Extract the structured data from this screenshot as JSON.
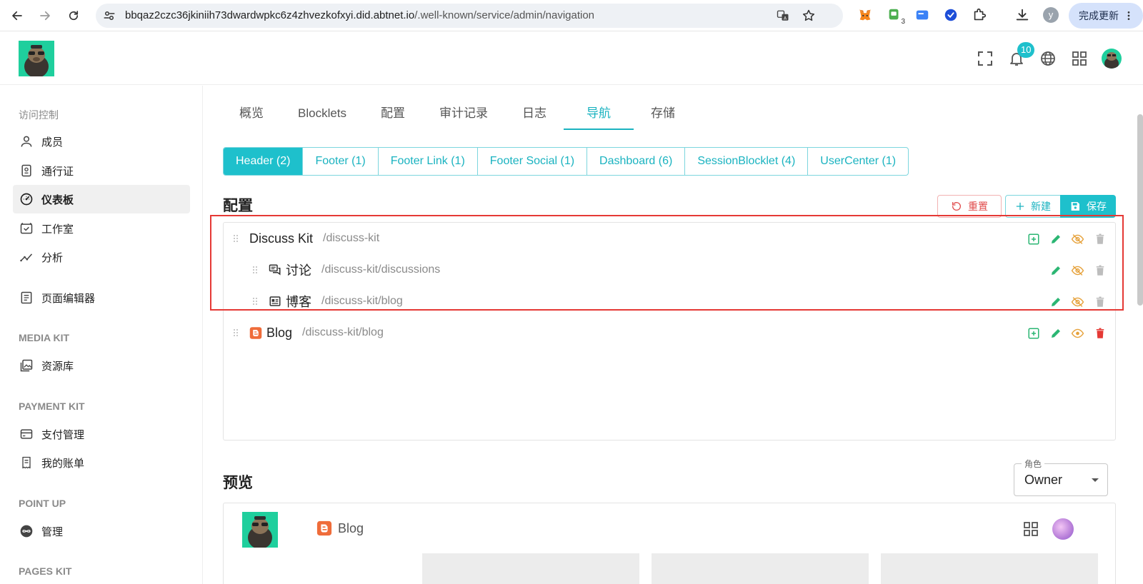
{
  "browser": {
    "url_host": "bbqaz2czc36jkiniih73dwardwpkc6z4zhvezkofxyi.did.abtnet.io",
    "url_path": "/.well-known/service/admin/navigation",
    "update_label": "完成更新",
    "profile_initial": "y",
    "extension_badge": "3"
  },
  "header": {
    "notification_count": "10"
  },
  "sidebar": {
    "groups": [
      {
        "title": "访问控制"
      },
      {
        "title": "MEDIA KIT"
      },
      {
        "title": "PAYMENT KIT"
      },
      {
        "title": "POINT UP"
      },
      {
        "title": "PAGES KIT"
      }
    ],
    "items": [
      {
        "label": "成员",
        "icon": "user-icon"
      },
      {
        "label": "通行证",
        "icon": "passport-icon"
      },
      {
        "label": "仪表板",
        "icon": "dashboard-icon",
        "active": true
      },
      {
        "label": "工作室",
        "icon": "studio-icon"
      },
      {
        "label": "分析",
        "icon": "analytics-icon"
      },
      {
        "label": "页面编辑器",
        "icon": "page-editor-icon"
      },
      {
        "label": "资源库",
        "icon": "library-icon"
      },
      {
        "label": "支付管理",
        "icon": "payment-icon"
      },
      {
        "label": "我的账单",
        "icon": "bill-icon"
      },
      {
        "label": "管理",
        "icon": "infinity-icon"
      }
    ]
  },
  "tabs": [
    {
      "label": "概览"
    },
    {
      "label": "Blocklets"
    },
    {
      "label": "配置"
    },
    {
      "label": "审计记录"
    },
    {
      "label": "日志"
    },
    {
      "label": "导航",
      "active": true
    },
    {
      "label": "存储"
    }
  ],
  "sections": [
    {
      "label": "Header (2)",
      "active": true
    },
    {
      "label": "Footer (1)"
    },
    {
      "label": "Footer Link (1)"
    },
    {
      "label": "Footer Social (1)"
    },
    {
      "label": "Dashboard (6)"
    },
    {
      "label": "SessionBlocklet (4)"
    },
    {
      "label": "UserCenter (1)"
    }
  ],
  "config": {
    "title": "配置",
    "reset_label": "重置",
    "new_label": "新建",
    "save_label": "保存",
    "rows": [
      {
        "title": "Discuss Kit",
        "path": "/discuss-kit",
        "level": 0,
        "visible": false
      },
      {
        "title": "讨论",
        "path": "/discuss-kit/discussions",
        "level": 1,
        "icon": "discussion-icon",
        "visible": false
      },
      {
        "title": "博客",
        "path": "/discuss-kit/blog",
        "level": 1,
        "icon": "article-icon",
        "visible": false
      },
      {
        "title": "Blog",
        "path": "/discuss-kit/blog",
        "level": 0,
        "icon": "blogger-icon",
        "visible": true
      }
    ]
  },
  "preview": {
    "title": "预览",
    "role_label": "角色",
    "role_value": "Owner",
    "nav_item": "Blog"
  },
  "colors": {
    "accent": "#1ec0cc",
    "danger": "#e53935",
    "success": "#2bb673",
    "warning": "#e6a23c",
    "blogger": "#ef6c3a"
  }
}
